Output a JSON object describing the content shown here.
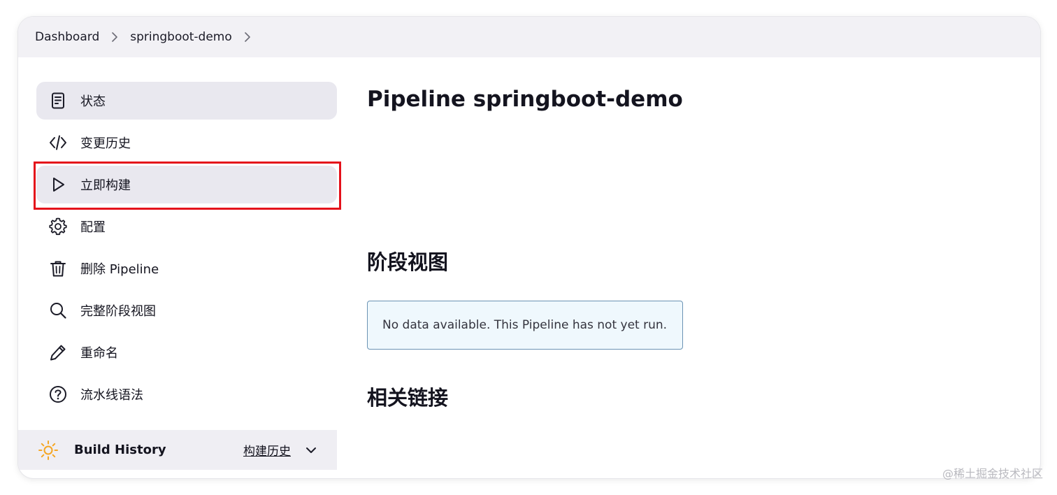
{
  "breadcrumb": {
    "items": [
      "Dashboard",
      "springboot-demo"
    ]
  },
  "sidebar": {
    "items": [
      {
        "label": "状态",
        "icon": "document-icon",
        "state": "active"
      },
      {
        "label": "变更历史",
        "icon": "code-icon",
        "state": "normal"
      },
      {
        "label": "立即构建",
        "icon": "play-icon",
        "state": "highlighted"
      },
      {
        "label": "配置",
        "icon": "gear-icon",
        "state": "normal"
      },
      {
        "label": "删除 Pipeline",
        "icon": "trash-icon",
        "state": "normal"
      },
      {
        "label": "完整阶段视图",
        "icon": "search-icon",
        "state": "normal"
      },
      {
        "label": "重命名",
        "icon": "pencil-icon",
        "state": "normal"
      },
      {
        "label": "流水线语法",
        "icon": "help-icon",
        "state": "normal"
      }
    ]
  },
  "build_history": {
    "title": "Build History",
    "link": "构建历史",
    "icon": "sun-icon",
    "icon_color": "#f5a623"
  },
  "main": {
    "title": "Pipeline springboot-demo",
    "stage_view_title": "阶段视图",
    "no_data_message": "No data available. This Pipeline has not yet run.",
    "related_links_title": "相关链接"
  },
  "annotation": {
    "highlight_color": "#e4111b"
  },
  "watermark": "@稀土掘金技术社区"
}
